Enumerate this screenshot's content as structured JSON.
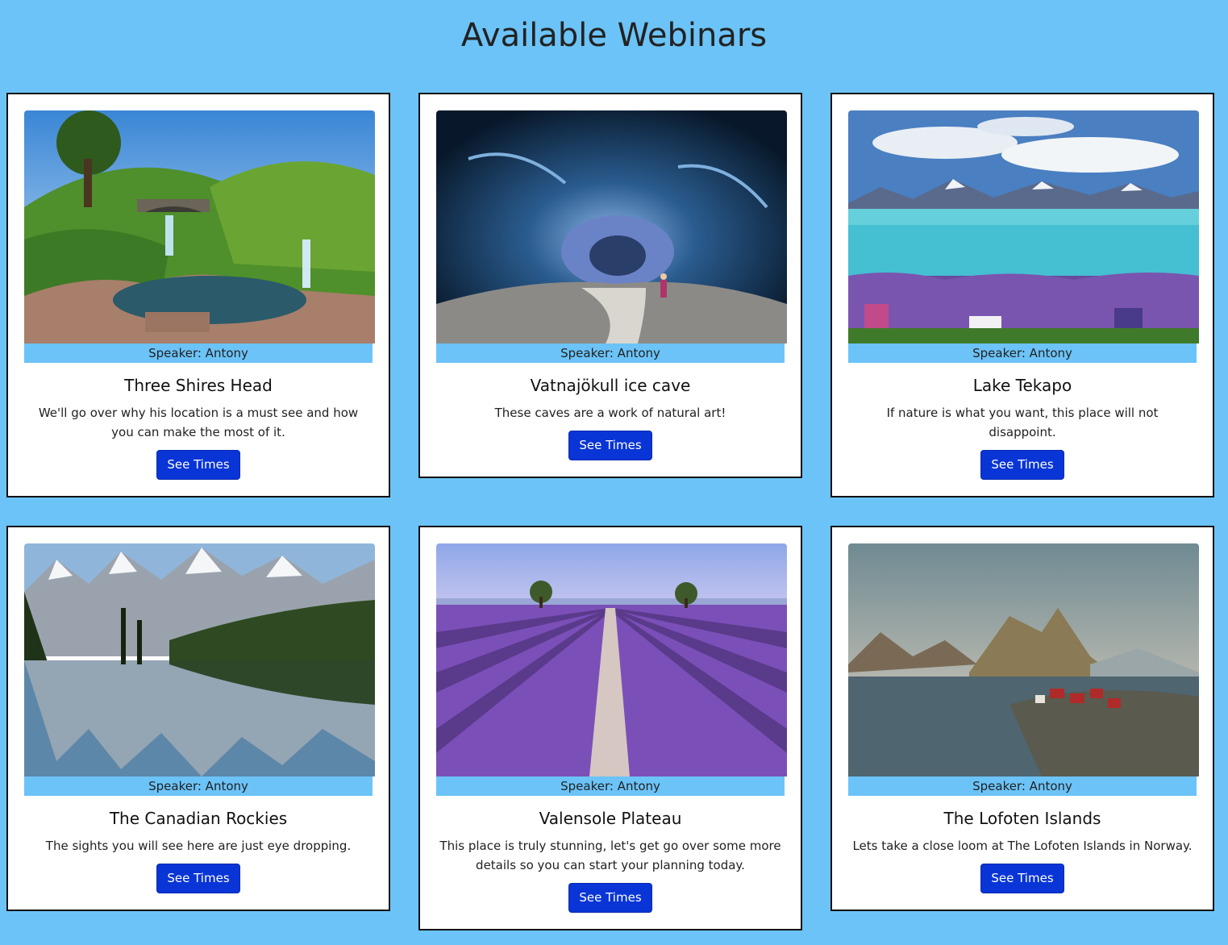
{
  "page": {
    "title": "Available Webinars",
    "background_color": "#6cc3f7",
    "button_color": "#0935d6"
  },
  "webinars": [
    {
      "image_subject": "waterfall-stream-landscape",
      "speaker": "Speaker: Antony",
      "title": "Three Shires Head",
      "description": "We'll go over why his location is a must see and how you can make the most of it.",
      "button_label": "See Times"
    },
    {
      "image_subject": "blue-ice-cave",
      "speaker": "Speaker: Antony",
      "title": "Vatnajökull ice cave",
      "description": "These caves are a work of natural art!",
      "button_label": "See Times"
    },
    {
      "image_subject": "lake-with-lupine-flowers",
      "speaker": "Speaker: Antony",
      "title": "Lake Tekapo",
      "description": "If nature is what you want, this place will not disappoint.",
      "button_label": "See Times"
    },
    {
      "image_subject": "mountain-lake-reflection",
      "speaker": "Speaker: Antony",
      "title": "The Canadian Rockies",
      "description": "The sights you will see here are just eye dropping.",
      "button_label": "See Times"
    },
    {
      "image_subject": "lavender-field-rows",
      "speaker": "Speaker: Antony",
      "title": "Valensole Plateau",
      "description": "This place is truly stunning, let's get go over some more details so you can start your planning today.",
      "button_label": "See Times"
    },
    {
      "image_subject": "coastal-village-mountain",
      "speaker": "Speaker: Antony",
      "title": "The Lofoten Islands",
      "description": "Lets take a close loom at The Lofoten Islands in Norway.",
      "button_label": "See Times"
    }
  ]
}
